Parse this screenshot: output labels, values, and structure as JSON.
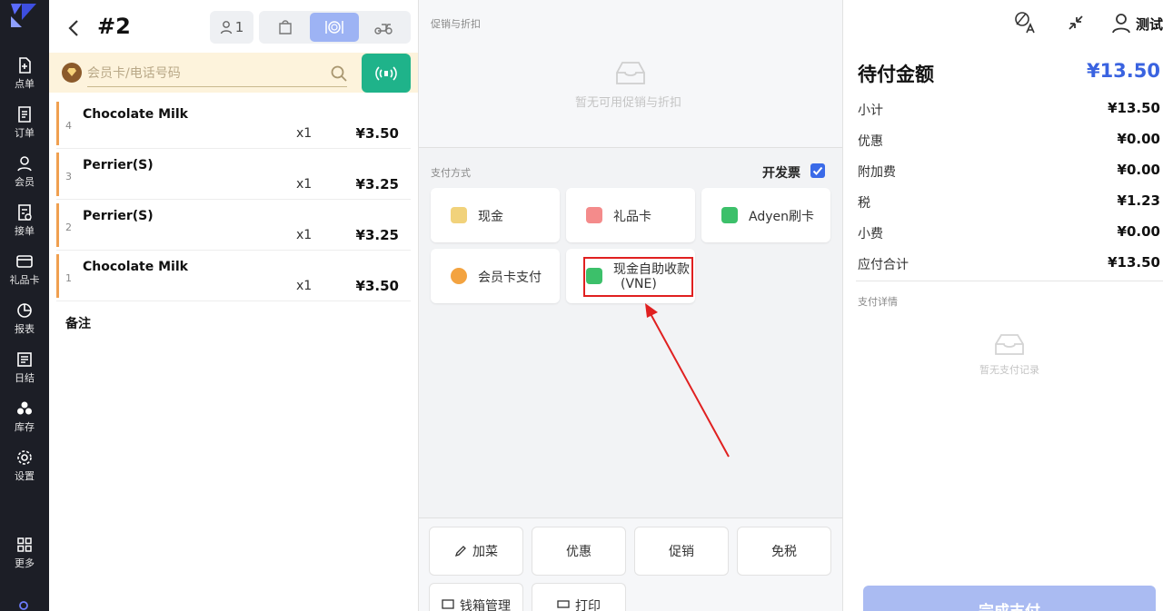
{
  "nav": {
    "items": [
      {
        "label": "点单",
        "icon": "add-file-icon"
      },
      {
        "label": "订单",
        "icon": "order-list-icon"
      },
      {
        "label": "会员",
        "icon": "user-icon"
      },
      {
        "label": "接单",
        "icon": "accept-order-icon"
      },
      {
        "label": "礼品卡",
        "icon": "card-icon"
      },
      {
        "label": "报表",
        "icon": "pie-chart-icon"
      },
      {
        "label": "日结",
        "icon": "daily-settle-icon"
      },
      {
        "label": "库存",
        "icon": "inventory-icon"
      },
      {
        "label": "设置",
        "icon": "gear-icon"
      },
      {
        "label": "更多",
        "icon": "grid-icon"
      }
    ]
  },
  "order": {
    "number": "#2",
    "guests": "1",
    "member_placeholder": "会员卡/电话号码",
    "items": [
      {
        "index": "4",
        "name": "Chocolate Milk",
        "qty": "x1",
        "price": "¥3.50"
      },
      {
        "index": "3",
        "name": "Perrier(S)",
        "qty": "x1",
        "price": "¥3.25"
      },
      {
        "index": "2",
        "name": "Perrier(S)",
        "qty": "x1",
        "price": "¥3.25"
      },
      {
        "index": "1",
        "name": "Chocolate Milk",
        "qty": "x1",
        "price": "¥3.50"
      }
    ],
    "remark_label": "备注"
  },
  "promo": {
    "title": "促销与折扣",
    "empty": "暂无可用促销与折扣"
  },
  "payment": {
    "title": "支付方式",
    "invoice_label": "开发票",
    "methods": [
      {
        "label": "现金",
        "color": "#e8b93a"
      },
      {
        "label": "礼品卡",
        "color": "#f07070"
      },
      {
        "label": "Adyen刷卡",
        "color": "#3cc06a"
      },
      {
        "label": "会员卡支付",
        "color": "#f09a30"
      },
      {
        "label": "现金自助收款",
        "label2": "(VNE)",
        "color": "#3cc06a"
      }
    ]
  },
  "actions": [
    "加菜",
    "优惠",
    "促销",
    "免税",
    "钱箱管理",
    "打印"
  ],
  "summary": {
    "user": "测试",
    "due_label": "待付金额",
    "due_value": "¥13.50",
    "rows": [
      {
        "label": "小计",
        "value": "¥13.50"
      },
      {
        "label": "优惠",
        "value": "¥0.00"
      },
      {
        "label": "附加费",
        "value": "¥0.00"
      },
      {
        "label": "税",
        "value": "¥1.23"
      },
      {
        "label": "小费",
        "value": "¥0.00"
      },
      {
        "label": "应付合计",
        "value": "¥13.50"
      }
    ],
    "detail_title": "支付详情",
    "detail_empty": "暂无支付记录",
    "complete_label": "完成支付"
  }
}
